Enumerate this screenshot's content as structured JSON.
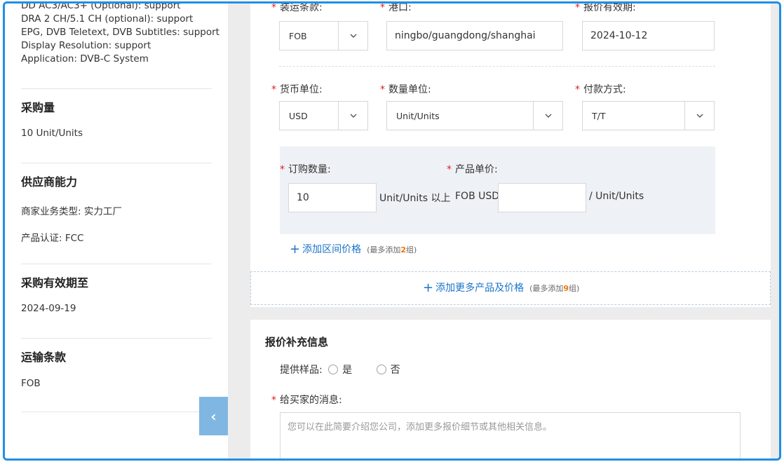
{
  "sidebar": {
    "spec_lines": [
      "DD AC3/AC3+ (Optional): support",
      "DRA 2 CH/5.1 CH (optional): support",
      "EPG, DVB Teletext, DVB Subtitles: support",
      "Display Resolution: support",
      "Application: DVB-C System"
    ],
    "purchase_qty_title": "采购量",
    "purchase_qty_value": "10 Unit/Units",
    "supplier_title": "供应商能力",
    "business_type": "商家业务类型: 实力工厂",
    "certification": "产品认证: FCC",
    "valid_until_title": "采购有效期至",
    "valid_until_value": "2024-09-19",
    "shipping_title": "运输条款",
    "shipping_value": "FOB",
    "collapse_glyph": "‹"
  },
  "form": {
    "trade_terms_label": "装运条款:",
    "trade_terms_value": "FOB",
    "port_label": "港口:",
    "port_value": "ningbo/guangdong/shanghai",
    "quote_valid_label": "报价有效期:",
    "quote_valid_value": "2024-10-12",
    "currency_label": "货币单位:",
    "currency_value": "USD",
    "qty_unit_label": "数量单位:",
    "qty_unit_value": "Unit/Units",
    "payment_label": "付款方式:",
    "payment_value": "T/T",
    "order_qty_label": "订购数量:",
    "order_qty_value": "10",
    "order_qty_suffix": "Unit/Units 以上",
    "unit_price_label": "产品单价:",
    "price_prefix": "FOB USD",
    "price_value": "",
    "price_suffix": "/ Unit/Units",
    "add_tier_link": "添加区间价格",
    "add_tier_hint_pre": "(最多添加",
    "add_tier_hint_num": "2",
    "add_tier_hint_post": "组)",
    "add_product_link": "添加更多产品及价格",
    "add_product_hint_pre": "(最多添加",
    "add_product_hint_num": "9",
    "add_product_hint_post": "组)"
  },
  "supplement": {
    "title": "报价补充信息",
    "sample_label": "提供样品:",
    "yes_label": "是",
    "no_label": "否",
    "message_label": "给买家的消息:",
    "message_placeholder": "您可以在此简要介绍您公司，添加更多报价细节或其他相关信息。"
  },
  "colors": {
    "accent": "#1a73c9",
    "required_star": "#e02020",
    "highlight_number": "#ee7700",
    "frame_border": "#1f8fe6"
  }
}
